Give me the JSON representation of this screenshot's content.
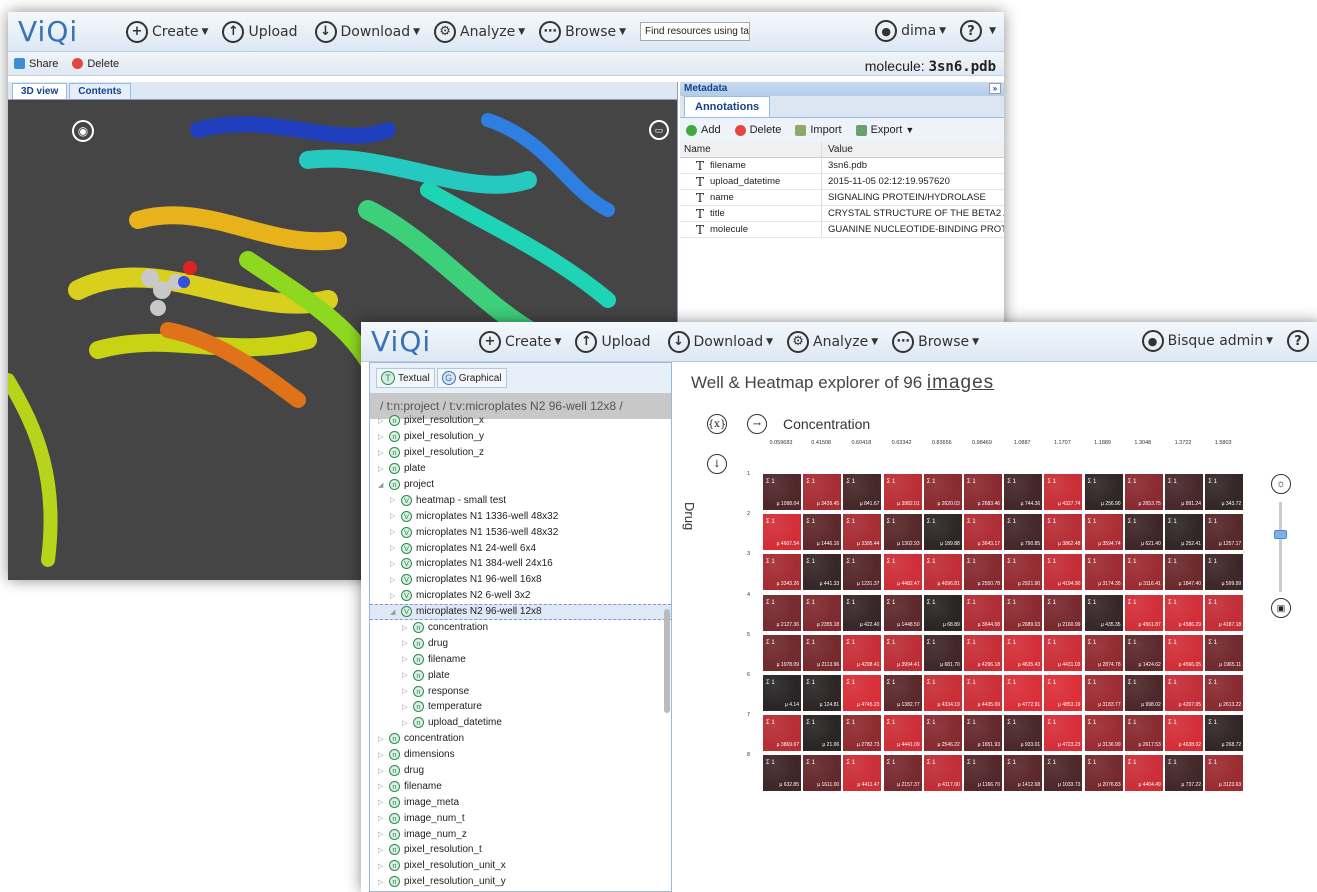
{
  "win1": {
    "logo": "ViQi",
    "menu": [
      {
        "label": "Create",
        "icon": "+"
      },
      {
        "label": "Upload",
        "icon": "↑"
      },
      {
        "label": "Download",
        "icon": "↓"
      },
      {
        "label": "Analyze",
        "icon": "⚙"
      },
      {
        "label": "Browse",
        "icon": "⋯"
      }
    ],
    "search_placeholder": "Find resources using tag",
    "user": "dima",
    "help": "?",
    "toolbar": {
      "share": "Share",
      "delete": "Delete"
    },
    "molecule_label": "molecule:",
    "molecule_value": "3sn6.pdb",
    "tabs": [
      "3D view",
      "Contents"
    ],
    "metadata_title": "Metadata",
    "annotations_tab": "Annotations",
    "ann_toolbar": {
      "add": "Add",
      "delete": "Delete",
      "import": "Import",
      "export": "Export"
    },
    "grid_headers": [
      "Name",
      "Value"
    ],
    "rows": [
      {
        "name": "filename",
        "value": "3sn6.pdb"
      },
      {
        "name": "upload_datetime",
        "value": "2015-11-05 02:12:19.957620"
      },
      {
        "name": "name",
        "value": "SIGNALING PROTEIN/HYDROLASE"
      },
      {
        "name": "title",
        "value": "CRYSTAL STRUCTURE OF THE BETA2 A..."
      },
      {
        "name": "molecule",
        "value": "GUANINE NUCLEOTIDE-BINDING PROTE..."
      }
    ]
  },
  "win2": {
    "logo": "ViQi",
    "menu": [
      {
        "label": "Create",
        "icon": "+"
      },
      {
        "label": "Upload",
        "icon": "↑"
      },
      {
        "label": "Download",
        "icon": "↓"
      },
      {
        "label": "Analyze",
        "icon": "⚙"
      },
      {
        "label": "Browse",
        "icon": "⋯"
      }
    ],
    "user": "Bisque admin",
    "help": "?",
    "btn_textual": "Textual",
    "btn_graphical": "Graphical",
    "breadcrumb": "/ t:n:project / t:v:microplates N2 96-well 12x8 /",
    "tree": [
      {
        "t": "pixel_resolution_x",
        "b": "n",
        "lv": 0,
        "ex": false
      },
      {
        "t": "pixel_resolution_y",
        "b": "n",
        "lv": 0,
        "ex": false
      },
      {
        "t": "pixel_resolution_z",
        "b": "n",
        "lv": 0,
        "ex": false
      },
      {
        "t": "plate",
        "b": "n",
        "lv": 0,
        "ex": false
      },
      {
        "t": "project",
        "b": "n",
        "lv": 0,
        "ex": true
      },
      {
        "t": "heatmap - small test",
        "b": "V",
        "lv": 1,
        "ex": false
      },
      {
        "t": "microplates N1 1336-well 48x32",
        "b": "V",
        "lv": 1,
        "ex": false
      },
      {
        "t": "microplates N1 1536-well 48x32",
        "b": "V",
        "lv": 1,
        "ex": false
      },
      {
        "t": "microplates N1 24-well 6x4",
        "b": "V",
        "lv": 1,
        "ex": false
      },
      {
        "t": "microplates N1 384-well 24x16",
        "b": "V",
        "lv": 1,
        "ex": false
      },
      {
        "t": "microplates N1 96-well 16x8",
        "b": "V",
        "lv": 1,
        "ex": false
      },
      {
        "t": "microplates N2 6-well 3x2",
        "b": "V",
        "lv": 1,
        "ex": false
      },
      {
        "t": "microplates N2 96-well 12x8",
        "b": "V",
        "lv": 1,
        "ex": true,
        "sel": true
      },
      {
        "t": "concentration",
        "b": "n",
        "lv": 2,
        "ex": false
      },
      {
        "t": "drug",
        "b": "n",
        "lv": 2,
        "ex": false
      },
      {
        "t": "filename",
        "b": "n",
        "lv": 2,
        "ex": false
      },
      {
        "t": "plate",
        "b": "n",
        "lv": 2,
        "ex": false
      },
      {
        "t": "response",
        "b": "n",
        "lv": 2,
        "ex": false
      },
      {
        "t": "temperature",
        "b": "n",
        "lv": 2,
        "ex": false
      },
      {
        "t": "upload_datetime",
        "b": "n",
        "lv": 2,
        "ex": false
      },
      {
        "t": "concentration",
        "b": "n",
        "lv": 0,
        "ex": false
      },
      {
        "t": "dimensions",
        "b": "n",
        "lv": 0,
        "ex": false
      },
      {
        "t": "drug",
        "b": "n",
        "lv": 0,
        "ex": false
      },
      {
        "t": "filename",
        "b": "n",
        "lv": 0,
        "ex": false
      },
      {
        "t": "image_meta",
        "b": "n",
        "lv": 0,
        "ex": false
      },
      {
        "t": "image_num_t",
        "b": "n",
        "lv": 0,
        "ex": false
      },
      {
        "t": "image_num_z",
        "b": "n",
        "lv": 0,
        "ex": false
      },
      {
        "t": "pixel_resolution_t",
        "b": "n",
        "lv": 0,
        "ex": false
      },
      {
        "t": "pixel_resolution_unit_x",
        "b": "n",
        "lv": 0,
        "ex": false
      },
      {
        "t": "pixel_resolution_unit_y",
        "b": "n",
        "lv": 0,
        "ex": false
      }
    ],
    "heatmap": {
      "title_prefix": "Well & Heatmap explorer of 96",
      "title_link": "images",
      "x_label": "Concentration",
      "y_label": "Drug",
      "x_icon": "{x}",
      "concentrations": [
        "0.059683",
        "0.41508",
        "0.60418",
        "0.63342",
        "0.83656",
        "0.98469",
        "1.0887",
        "1.1707",
        "1.1889",
        "1.3048",
        "1.3722",
        "1.5803"
      ],
      "sum_label": "Σ 1",
      "mean_prefix": "µ ",
      "means": [
        [
          "1098.04",
          "3439.45",
          "841.67",
          "3982.01",
          "2620.03",
          "2683.46",
          "744.36",
          "4327.74",
          "256.90",
          "2653.75",
          "891.24",
          "343.72"
        ],
        [
          "4607.54",
          "1446.16",
          "3395.44",
          "1302.93",
          "189.88",
          "3643.17",
          "790.85",
          "3862.48",
          "3594.74",
          "621.40",
          "252.41",
          "1257.17"
        ],
        [
          "3343.26",
          "441.33",
          "1231.37",
          "4482.47",
          "4096.81",
          "2550.78",
          "2921.90",
          "4194.90",
          "3174.35",
          "3116.41",
          "1847.40",
          "599.99"
        ],
        [
          "2127.36",
          "2355.18",
          "422.40",
          "1448.50",
          "68.89",
          "3644.08",
          "2689.03",
          "2160.99",
          "435.35",
          "4561.87",
          "4586.29",
          "4187.18"
        ],
        [
          "1978.09",
          "2113.96",
          "4298.41",
          "3994.41",
          "681.70",
          "4296.18",
          "4635.43",
          "4431.03",
          "2874.78",
          "1424.62",
          "4566.05",
          "1965.11"
        ],
        [
          "4.14",
          "124.81",
          "4745.23",
          "1382.77",
          "4334.19",
          "4435.09",
          "4772.91",
          "4853.19",
          "3183.77",
          "998.02",
          "4207.05",
          "2613.22"
        ],
        [
          "3869.67",
          "21.06",
          "2782.73",
          "4441.09",
          "2546.22",
          "1651.93",
          "933.01",
          "4723.23",
          "3136.99",
          "2617.53",
          "4638.02",
          "268.72"
        ],
        [
          "632.85",
          "1611.00",
          "4411.47",
          "2157.37",
          "4117.00",
          "1166.70",
          "1412.68",
          "1033.73",
          "2076.83",
          "4404.49",
          "737.22",
          "3123.63"
        ]
      ]
    }
  }
}
